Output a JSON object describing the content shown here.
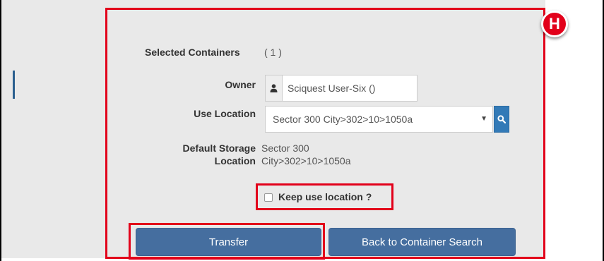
{
  "badge": "H",
  "selected_containers": {
    "label": "Selected Containers",
    "count": "( 1 )"
  },
  "owner": {
    "label": "Owner",
    "value": "Sciquest User-Six ()"
  },
  "use_location": {
    "label": "Use Location",
    "selected": "Sector 300 City>302>10>1050a"
  },
  "default_storage": {
    "label_line1": "Default Storage",
    "label_line2": "Location",
    "value_line1": "Sector 300",
    "value_line2": "City>302>10>1050a"
  },
  "keep_location": {
    "label": "Keep use location ?",
    "checked": false
  },
  "buttons": {
    "transfer": "Transfer",
    "back": "Back to Container Search"
  },
  "colors": {
    "highlight": "#e2001a",
    "primary_button": "#456e9f",
    "search_button": "#337ab7"
  },
  "icons": {
    "owner": "user-icon",
    "search": "search-icon",
    "dropdown": "caret-down-icon"
  }
}
